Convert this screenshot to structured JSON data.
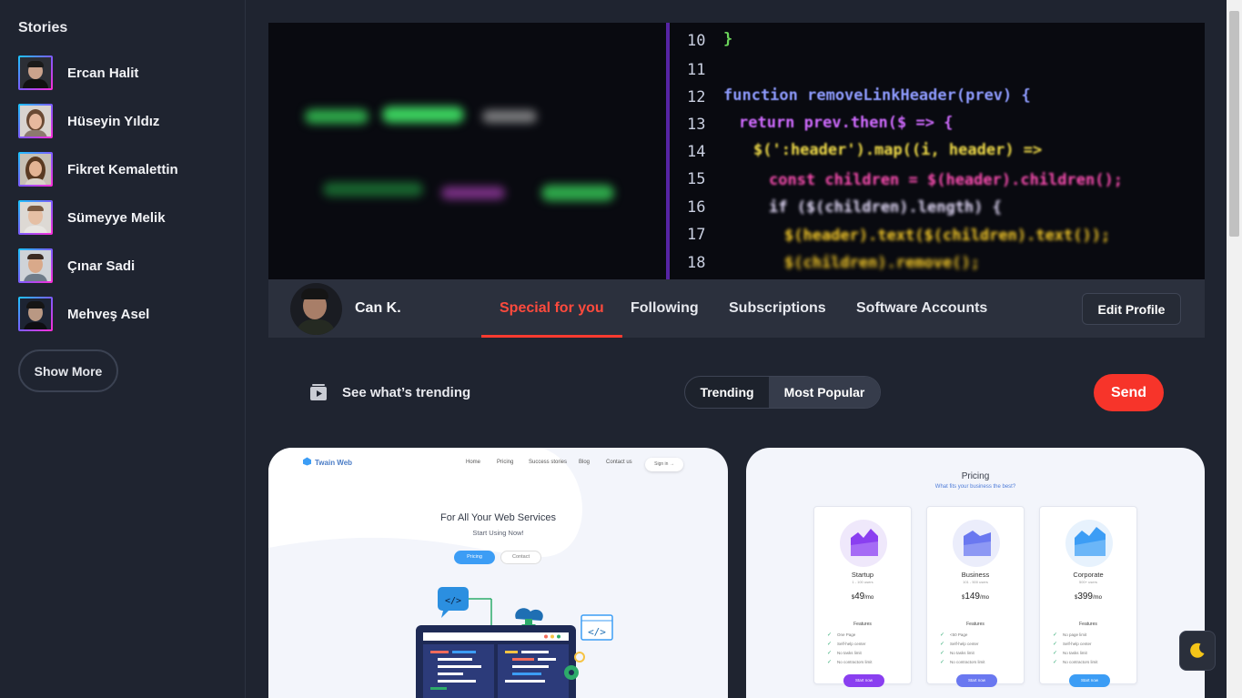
{
  "sidebar": {
    "title": "Stories",
    "stories": [
      {
        "name": "Ercan Halit"
      },
      {
        "name": "Hüseyin Yıldız"
      },
      {
        "name": "Fikret Kemalettin"
      },
      {
        "name": "Sümeyye Melik"
      },
      {
        "name": "Çınar Sadi"
      },
      {
        "name": "Mehveş Asel"
      }
    ],
    "show_more": "Show More"
  },
  "cover": {
    "line_numbers": [
      "10",
      "11",
      "12",
      "13",
      "14",
      "15",
      "16",
      "17",
      "18"
    ],
    "code_lines": [
      "}",
      "",
      "function removeLinkHeader(prev) {",
      "return prev.then($ => {",
      "$(':header').map((i, header) =>",
      "const children = $(header).children();",
      "if ($(children).length) {",
      "$(header).text($(children).text());",
      "$(children).remove();"
    ]
  },
  "profile": {
    "name": "Can K.",
    "tabs": [
      {
        "label": "Special for you",
        "active": true
      },
      {
        "label": "Following",
        "active": false
      },
      {
        "label": "Subscriptions",
        "active": false
      },
      {
        "label": "Software Accounts",
        "active": false
      }
    ],
    "edit_label": "Edit Profile"
  },
  "trending": {
    "label": "See what’s trending",
    "toggle_options": [
      "Trending",
      "Most Popular"
    ],
    "selected": "Trending",
    "send_label": "Send"
  },
  "card_web": {
    "brand": "Twain Web",
    "nav": [
      "Home",
      "Pricing",
      "Success stories",
      "Blog",
      "Contact us"
    ],
    "signin": "Sign in →",
    "hero_title": "For All Your Web Services",
    "hero_subtitle": "Start Using Now!",
    "btn_primary": "Pricing",
    "btn_secondary": "Contact"
  },
  "card_pricing": {
    "title": "Pricing",
    "subtitle": "What fits your business the best?",
    "plans": [
      {
        "name": "Startup",
        "meta": "1 - 100 users",
        "price": "49",
        "period": "/mo",
        "features": [
          "One Page",
          "Self-help center",
          "No tasks limit",
          "No contractors limit"
        ],
        "button": "Start now",
        "color": "#8a3ff0"
      },
      {
        "name": "Business",
        "meta": "101 - 500 users",
        "price": "149",
        "period": "/mo",
        "features": [
          "<50 Page",
          "Self-help center",
          "No tasks limit",
          "No contractors limit"
        ],
        "button": "Start now",
        "color": "#6a78f0"
      },
      {
        "name": "Corporate",
        "meta": "500+ users",
        "price": "399",
        "period": "/mo",
        "features": [
          "No page limit",
          "Self-help center",
          "No tasks limit",
          "No contractors limit"
        ],
        "button": "Start now",
        "color": "#3c9df5"
      }
    ]
  },
  "colors": {
    "background": "#1f2430",
    "panel": "#2b303d",
    "accent_red": "#f7342a",
    "story_ring": "#ff2bd6",
    "moon": "#f5c518"
  },
  "icons": {
    "trending": "video-icon",
    "dark_mode": "moon-icon"
  }
}
